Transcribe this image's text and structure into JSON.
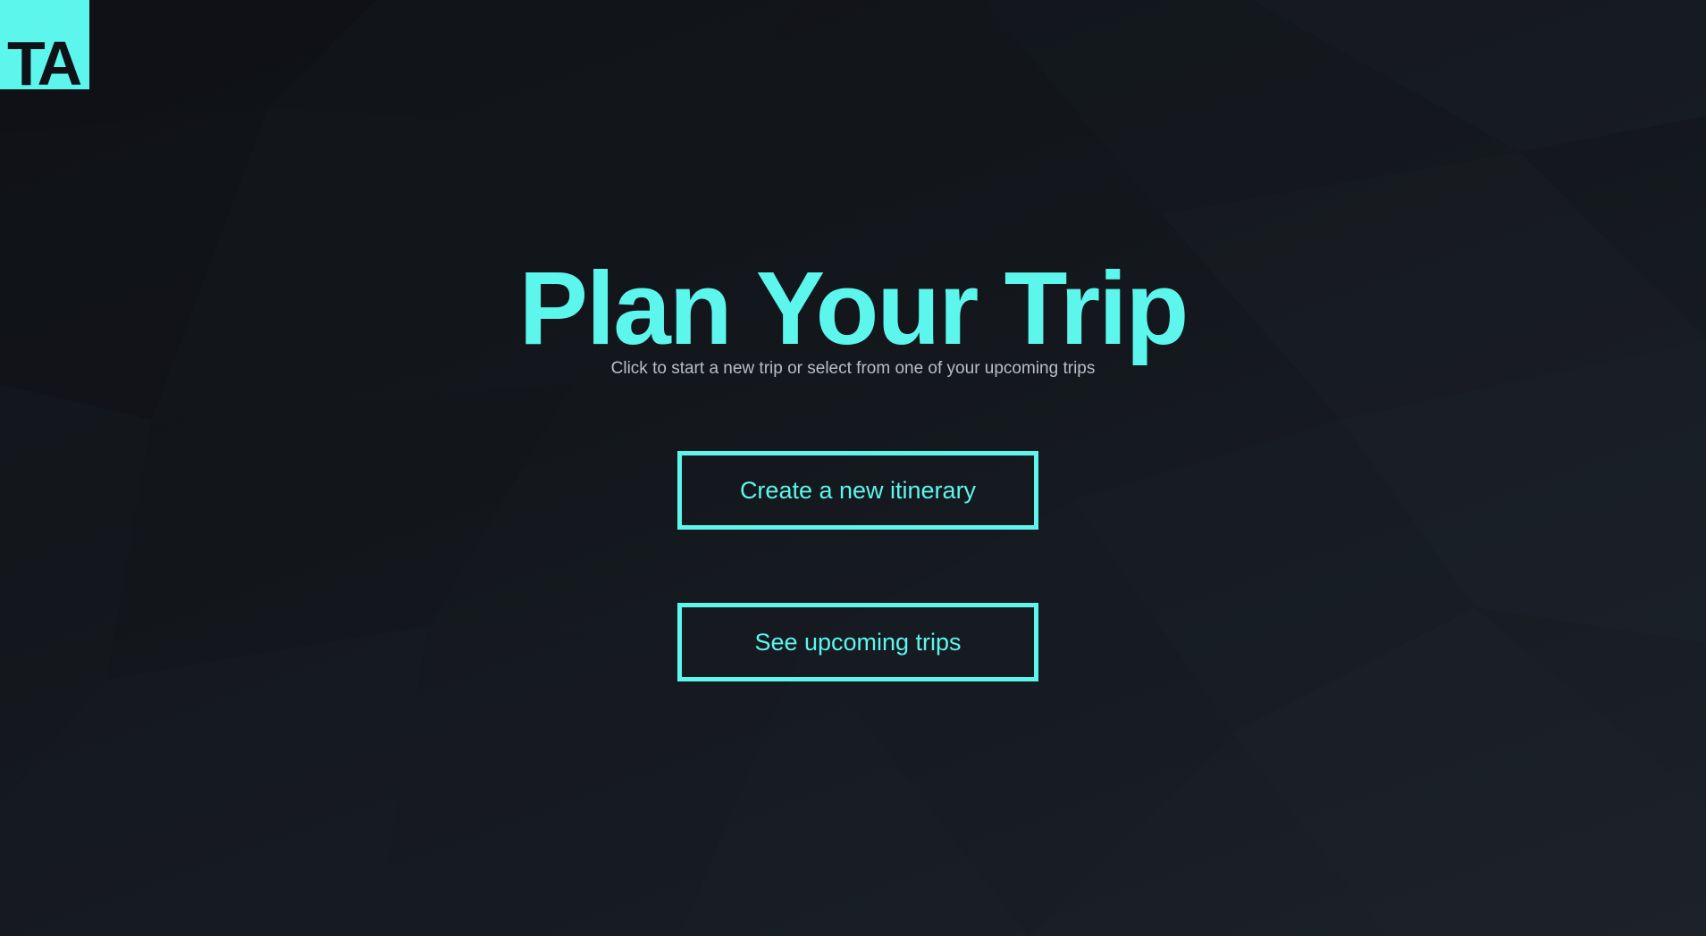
{
  "logo": {
    "text": "TA"
  },
  "hero": {
    "title": "Plan Your Trip",
    "subtitle": "Click to start a new trip or select from one of your upcoming trips"
  },
  "actions": {
    "create_label": "Create a new itinerary",
    "upcoming_label": "See upcoming trips"
  },
  "colors": {
    "accent": "#5cf6ed",
    "background": "#14181e",
    "subtitle_text": "#b9bec6"
  }
}
